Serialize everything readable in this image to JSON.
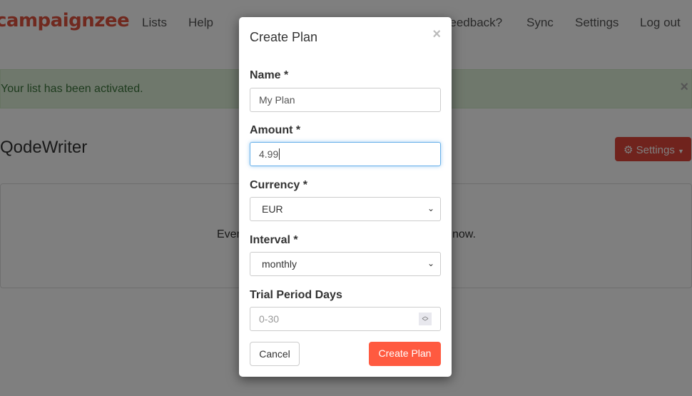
{
  "nav": {
    "brand": "campaignzee",
    "items": [
      "Lists",
      "Help",
      "Feedback?",
      "Sync",
      "Settings",
      "Log out"
    ]
  },
  "alert": {
    "message": "Your list has been activated.",
    "close": "×"
  },
  "page": {
    "title": "QodeWriter",
    "settings_button": "Settings",
    "panel_text_start": "Ever",
    "panel_text_end": "now."
  },
  "modal": {
    "title": "Create Plan",
    "close": "×",
    "fields": [
      {
        "label": "Name *",
        "value": "My Plan"
      },
      {
        "label": "Amount *",
        "value": "4.99"
      },
      {
        "label": "Currency *",
        "value": "EUR"
      },
      {
        "label": "Interval *",
        "value": "monthly"
      },
      {
        "label": "Trial Period Days",
        "placeholder": "0-30"
      }
    ],
    "cancel": "Cancel",
    "submit": "Create Plan"
  },
  "colors": {
    "brand": "#e0533e",
    "primary": "#ff5a40",
    "alert_bg": "#dff0d8"
  }
}
